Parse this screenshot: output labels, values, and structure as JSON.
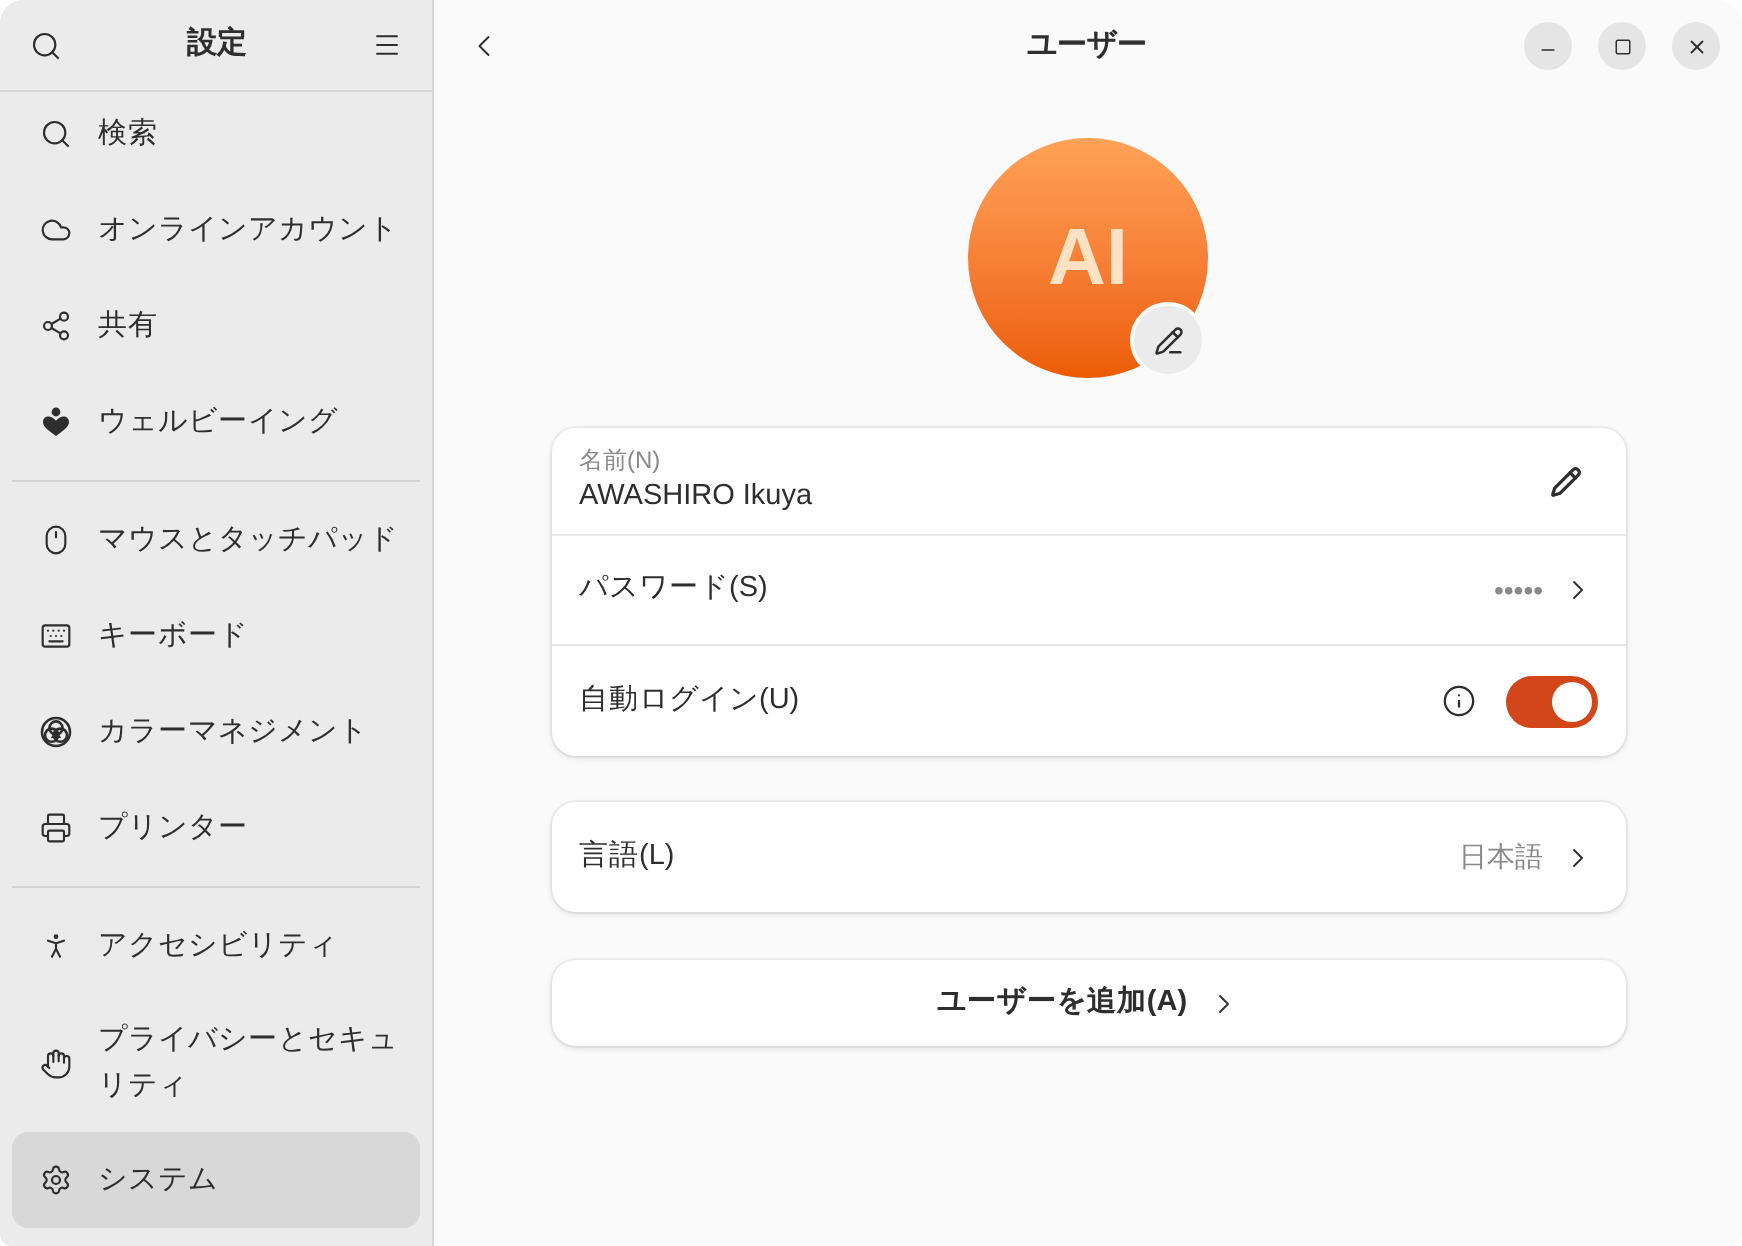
{
  "sidebar": {
    "title": "設定",
    "groups": [
      [
        {
          "label": "検索",
          "selected": false
        },
        {
          "label": "オンラインアカウント",
          "selected": false
        },
        {
          "label": "共有",
          "selected": false
        },
        {
          "label": "ウェルビーイング",
          "selected": false
        }
      ],
      [
        {
          "label": "マウスとタッチパッド",
          "selected": false
        },
        {
          "label": "キーボード",
          "selected": false
        },
        {
          "label": "カラーマネジメント",
          "selected": false
        },
        {
          "label": "プリンター",
          "selected": false
        }
      ],
      [
        {
          "label": "アクセシビリティ",
          "selected": false
        },
        {
          "label": "プライバシーとセキュリティ",
          "selected": false
        },
        {
          "label": "システム",
          "selected": true
        }
      ]
    ]
  },
  "page": {
    "title": "ユーザー"
  },
  "avatar": {
    "initials": "AI"
  },
  "account_card": {
    "rows": [
      {
        "kind": "name",
        "label": "名前(N)",
        "value": "AWASHIRO Ikuya"
      },
      {
        "kind": "link",
        "label": "パスワード(S)",
        "value": "•••••"
      },
      {
        "kind": "toggle",
        "label": "自動ログイン(U)",
        "on": true
      }
    ]
  },
  "language_card": {
    "rows": [
      {
        "kind": "link",
        "label": "言語(L)",
        "value": "日本語"
      }
    ]
  },
  "add_user_button": {
    "label": "ユーザーを追加(A)"
  }
}
